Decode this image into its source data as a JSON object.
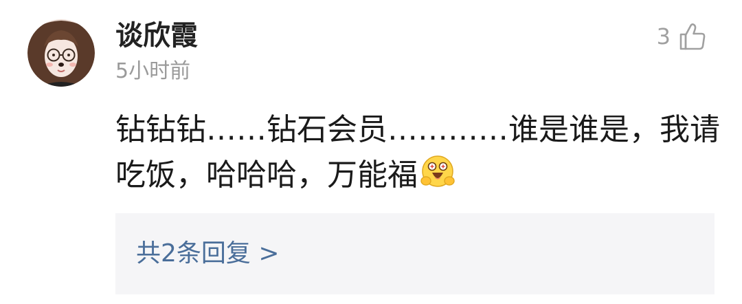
{
  "comment": {
    "username": "谈欣霞",
    "timestamp": "5小时前",
    "like_count": "3",
    "text": "钻钻钻……钻石会员…………谁是谁是，我请吃饭，哈哈哈，万能福",
    "emoji_icon": "hugging-face-emoji",
    "replies_label": "共2条回复 >"
  },
  "icons": {
    "avatar": "avatar",
    "like": "thumbs-up-icon"
  },
  "colors": {
    "username": "#222222",
    "timestamp": "#9a9a9a",
    "like": "#a0a0a0",
    "content": "#1a1a1a",
    "replies_bg": "#f5f5f7",
    "replies_link": "#4a6e9a"
  }
}
